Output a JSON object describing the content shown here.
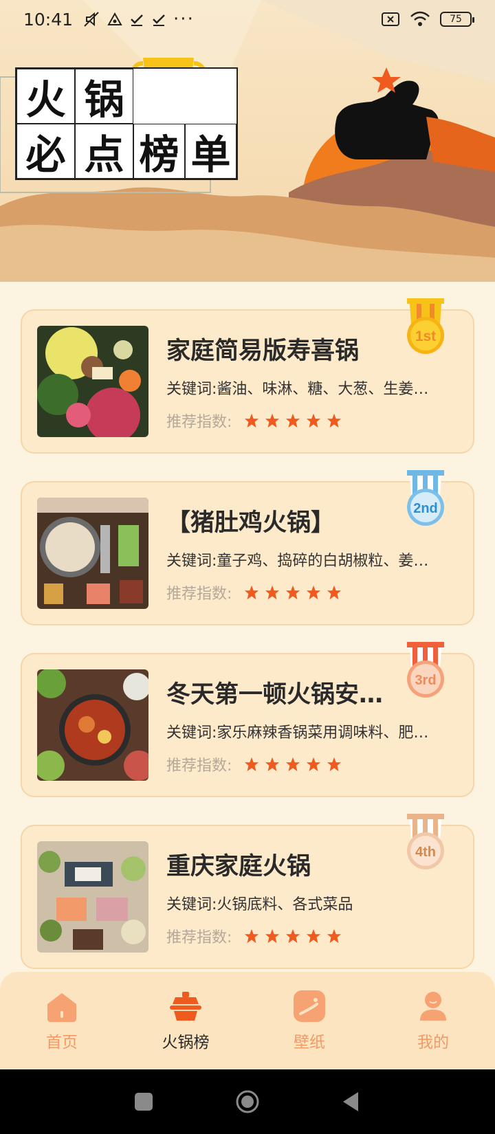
{
  "status_bar": {
    "time": "10:41",
    "dots": "···",
    "battery": "75"
  },
  "banner": {
    "title_chars": [
      "火",
      "锅",
      "必",
      "点",
      "榜",
      "单"
    ]
  },
  "rating_label": "推荐指数:",
  "recipes": [
    {
      "rank": "1st",
      "title": "家庭简易版寿喜锅",
      "keywords": "关键词:酱油、味淋、糖、大葱、生姜…",
      "stars": 5
    },
    {
      "rank": "2nd",
      "title": "【猪肚鸡火锅】",
      "keywords": "关键词:童子鸡、捣碎的白胡椒粒、姜…",
      "stars": 5
    },
    {
      "rank": "3rd",
      "title": "冬天第一顿火锅安…",
      "keywords": "关键词:家乐麻辣香锅菜用调味料、肥…",
      "stars": 5
    },
    {
      "rank": "4th",
      "title": "重庆家庭火锅",
      "keywords": "关键词:火锅底料、各式菜品",
      "stars": 5
    }
  ],
  "tabs": [
    {
      "label": "首页",
      "icon": "home-icon"
    },
    {
      "label": "火锅榜",
      "icon": "hotpot-icon",
      "active": true
    },
    {
      "label": "壁纸",
      "icon": "wallpaper-icon"
    },
    {
      "label": "我的",
      "icon": "profile-icon"
    }
  ],
  "colors": {
    "accent": "#f29a66",
    "star": "#ef5a1f",
    "card_bg": "#fdeacb",
    "page_bg": "#fdf3e1",
    "gold": "#f7c319",
    "silver": "#6fb8e6",
    "bronze": "#f08a5d",
    "fourth": "#e9b48a"
  }
}
